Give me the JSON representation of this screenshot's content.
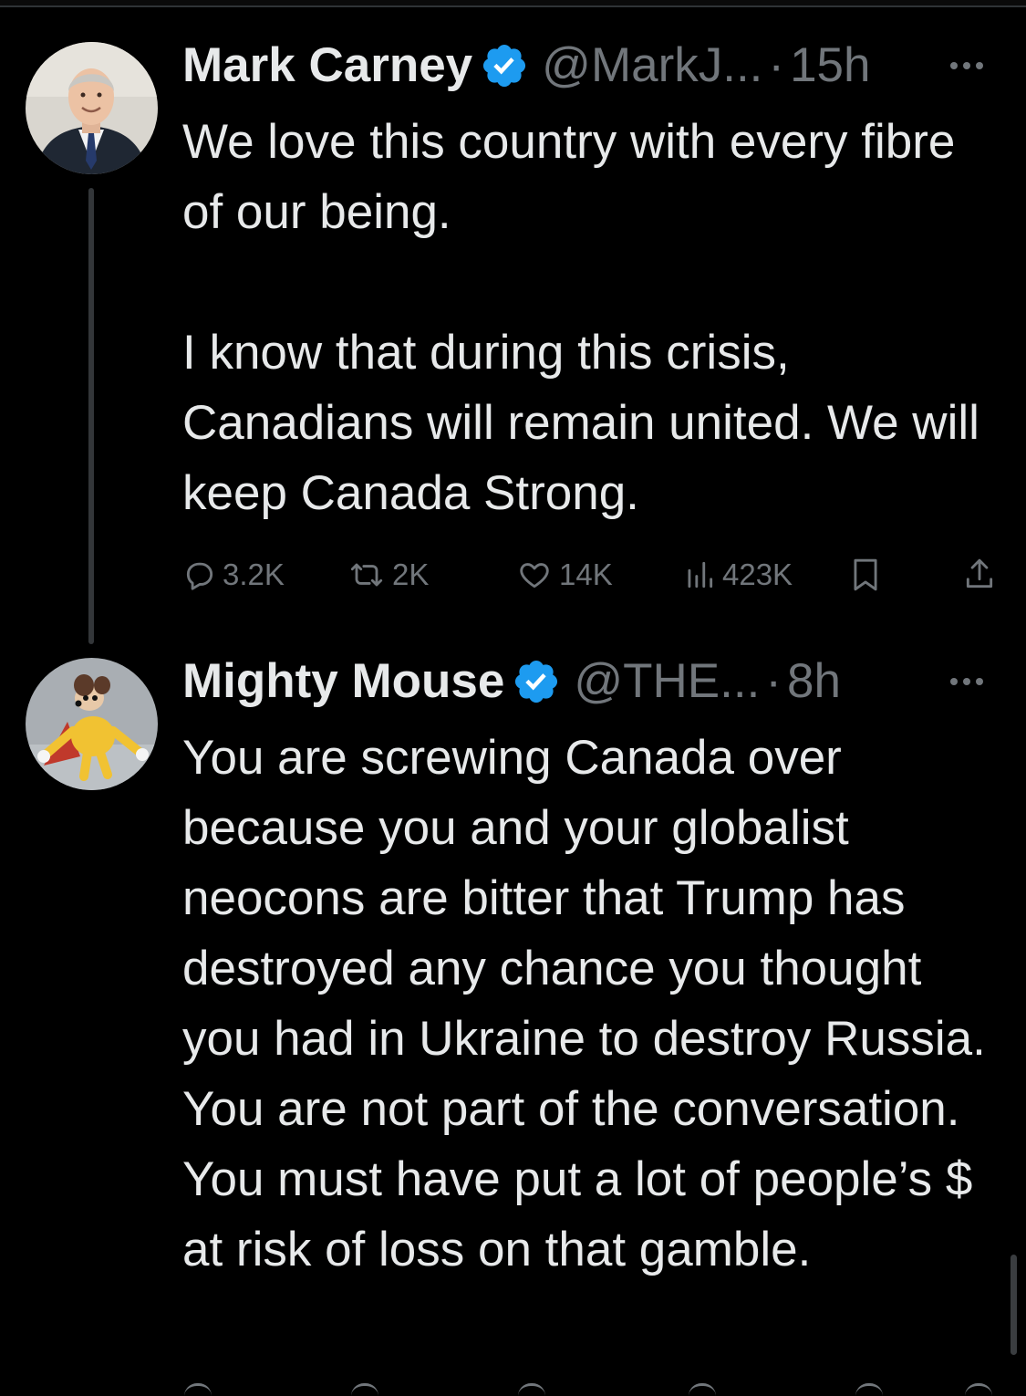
{
  "tweets": [
    {
      "author": {
        "name": "Mark Carney",
        "handle": "@MarkJ...",
        "verified": true,
        "avatar": "portrait-man-in-suit"
      },
      "time": "15h",
      "dot": "·",
      "text": [
        "We love this country with every fibre of our being.",
        "I know that during this crisis, Canadians will remain united. We will keep Canada Strong."
      ],
      "stats": {
        "replies": "3.2K",
        "reposts": "2K",
        "likes": "14K",
        "views": "423K"
      }
    },
    {
      "author": {
        "name": "Mighty Mouse",
        "handle": "@THE...",
        "verified": true,
        "avatar": "mighty-mouse-cartoon"
      },
      "time": "8h",
      "dot": "·",
      "text": [
        "You are screwing Canada over because you and your globalist neocons are bitter that Trump has destroyed any chance you thought you had in Ukraine to destroy Russia.  You are not part of the conversation.  You must have put a lot of people’s $ at risk of loss on that gamble."
      ]
    }
  ],
  "icons": {
    "verified": "verified-badge-icon",
    "more": "more-options-icon",
    "reply": "reply-icon",
    "repost": "repost-icon",
    "like": "like-icon",
    "views": "views-icon",
    "bookmark": "bookmark-icon",
    "share": "share-icon"
  },
  "colors": {
    "background": "#000000",
    "text": "#e7e9ea",
    "secondary": "#71767b",
    "verified": "#1d9bf0",
    "thread_line": "#333639"
  }
}
